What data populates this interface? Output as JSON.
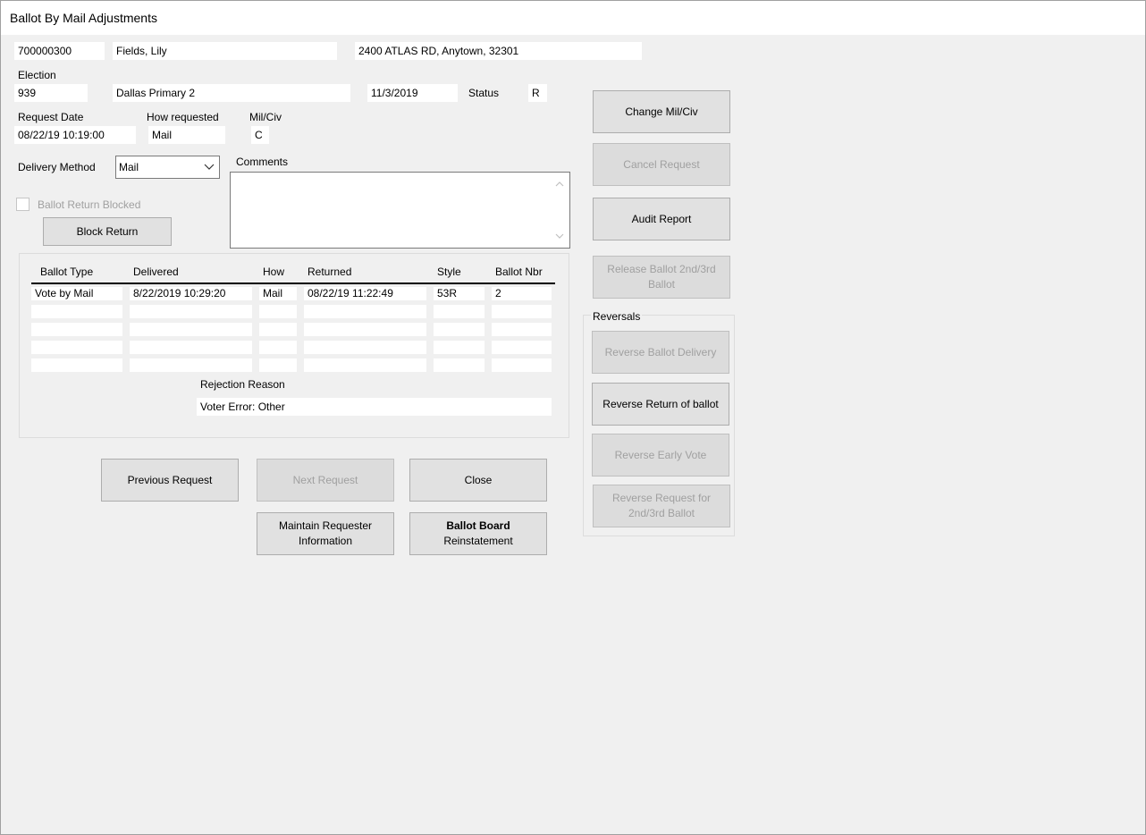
{
  "window": {
    "title": "Ballot By Mail Adjustments"
  },
  "voter": {
    "id": "700000300",
    "name": "Fields, Lily",
    "address": "2400 ATLAS RD, Anytown, 32301"
  },
  "election": {
    "label": "Election",
    "number": "939",
    "name": "Dallas Primary 2",
    "date": "11/3/2019",
    "status_label": "Status",
    "status_value": "R"
  },
  "request": {
    "date_label": "Request Date",
    "date_value": "08/22/19 10:19:00",
    "how_label": "How requested",
    "how_value": "Mail",
    "milciv_label": "Mil/Civ",
    "milciv_value": "C"
  },
  "delivery": {
    "label": "Delivery Method",
    "selected": "Mail"
  },
  "comments": {
    "label": "Comments",
    "value": ""
  },
  "blocked": {
    "label": "Ballot Return Blocked",
    "checked": false,
    "button": "Block Return"
  },
  "ballot_table": {
    "headers": [
      "Ballot Type",
      "Delivered",
      "How",
      "Returned",
      "Style",
      "Ballot Nbr"
    ],
    "rows": [
      [
        "Vote by Mail",
        "8/22/2019 10:29:20",
        "Mail",
        "08/22/19 11:22:49",
        "53R",
        "2"
      ],
      [
        "",
        "",
        "",
        "",
        "",
        ""
      ],
      [
        "",
        "",
        "",
        "",
        "",
        ""
      ],
      [
        "",
        "",
        "",
        "",
        "",
        ""
      ],
      [
        "",
        "",
        "",
        "",
        "",
        ""
      ]
    ],
    "rejection_label": "Rejection Reason",
    "rejection_value": "Voter Error: Other"
  },
  "bottom_buttons": {
    "previous": "Previous Request",
    "next": "Next Request",
    "close": "Close",
    "maintain": "Maintain Requester Information",
    "ballot_board_1": "Ballot Board",
    "ballot_board_2": "Reinstatement"
  },
  "side_buttons": {
    "change_milciv": "Change Mil/Civ",
    "cancel_request": "Cancel Request",
    "audit_report": "Audit Report",
    "release_ballot": "Release Ballot 2nd/3rd Ballot"
  },
  "reversals": {
    "label": "Reversals",
    "reverse_delivery": "Reverse Ballot Delivery",
    "reverse_return": "Reverse Return of ballot",
    "reverse_early_vote": "Reverse Early Vote",
    "reverse_request": "Reverse Request for 2nd/3rd Ballot"
  }
}
